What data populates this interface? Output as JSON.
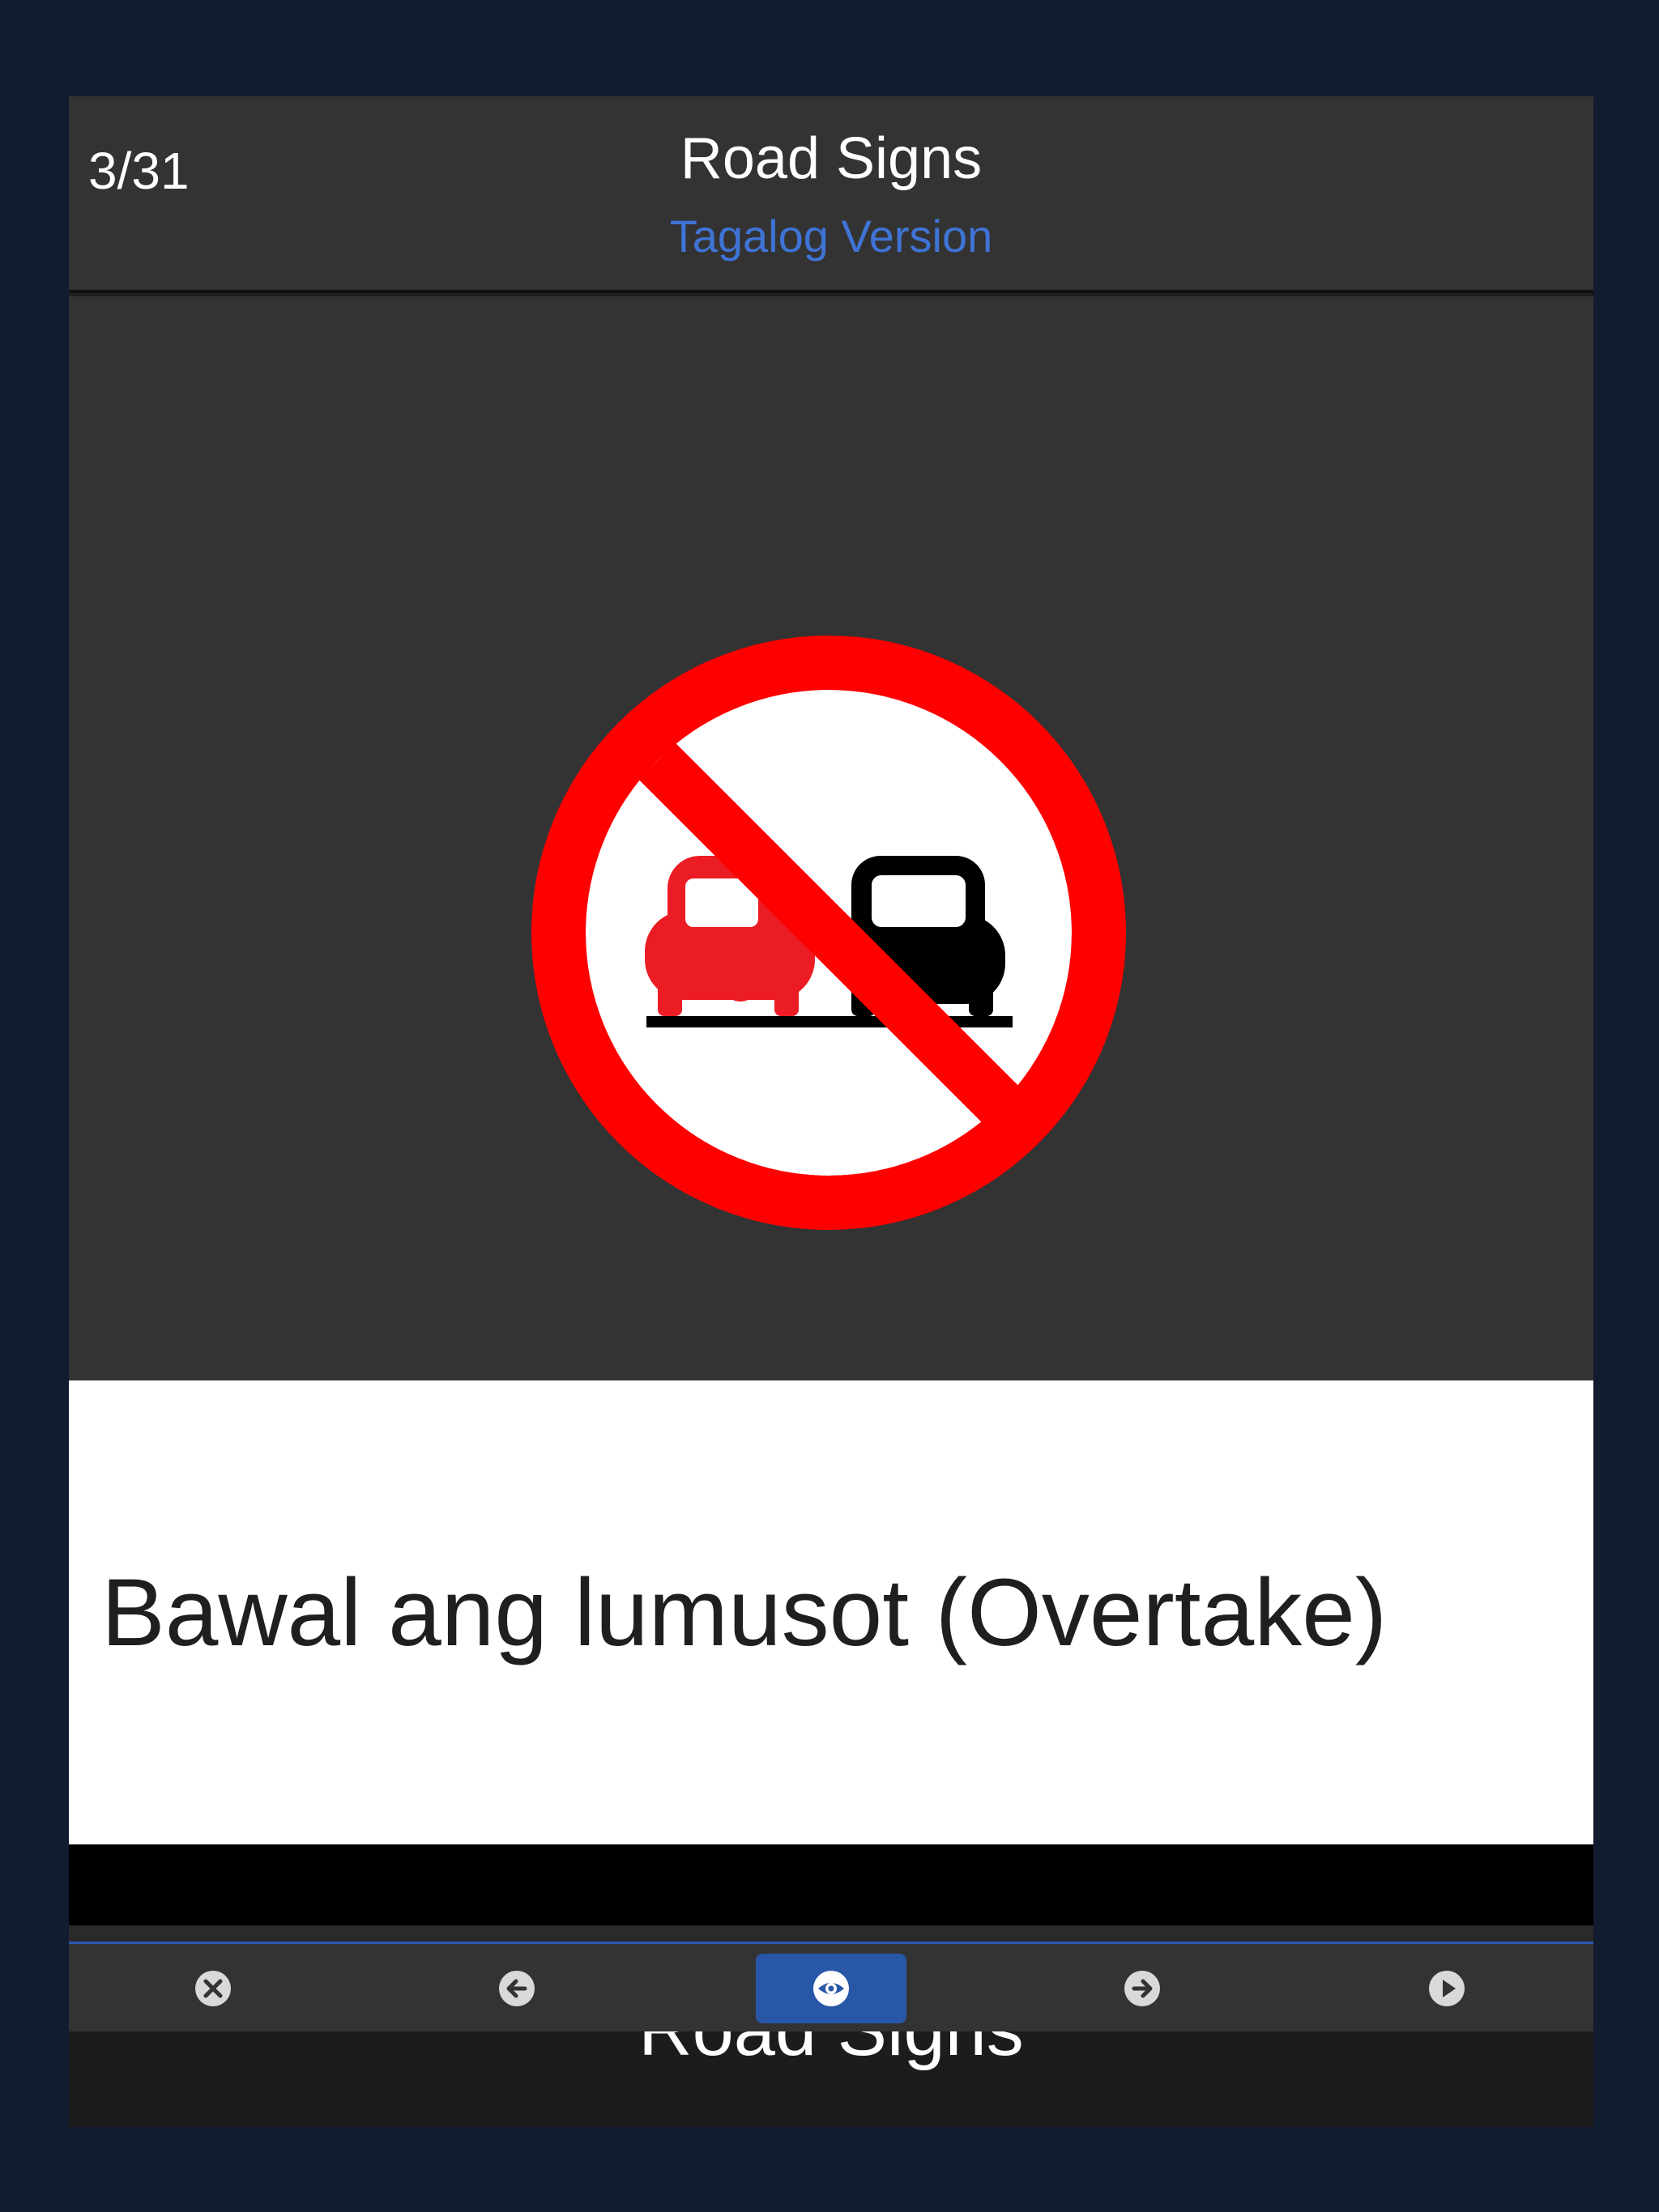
{
  "header": {
    "counter": "3/31",
    "title": "Road Signs",
    "subtitle": "Tagalog Version"
  },
  "sign": {
    "icon": "no-overtaking-sign",
    "ring_color": "#ff0000",
    "left_car_color": "#ec1c24",
    "right_car_color": "#000000"
  },
  "caption": {
    "text": "Bawal ang lumusot (Overtake)"
  },
  "toolbar": {
    "buttons": [
      {
        "icon": "close-circle-icon"
      },
      {
        "icon": "arrow-left-circle-icon"
      },
      {
        "icon": "eye-icon",
        "active": true
      },
      {
        "icon": "arrow-right-circle-icon"
      },
      {
        "icon": "play-circle-icon"
      }
    ],
    "active_color": "#2957a8"
  },
  "footer": {
    "title": "Road Signs"
  }
}
